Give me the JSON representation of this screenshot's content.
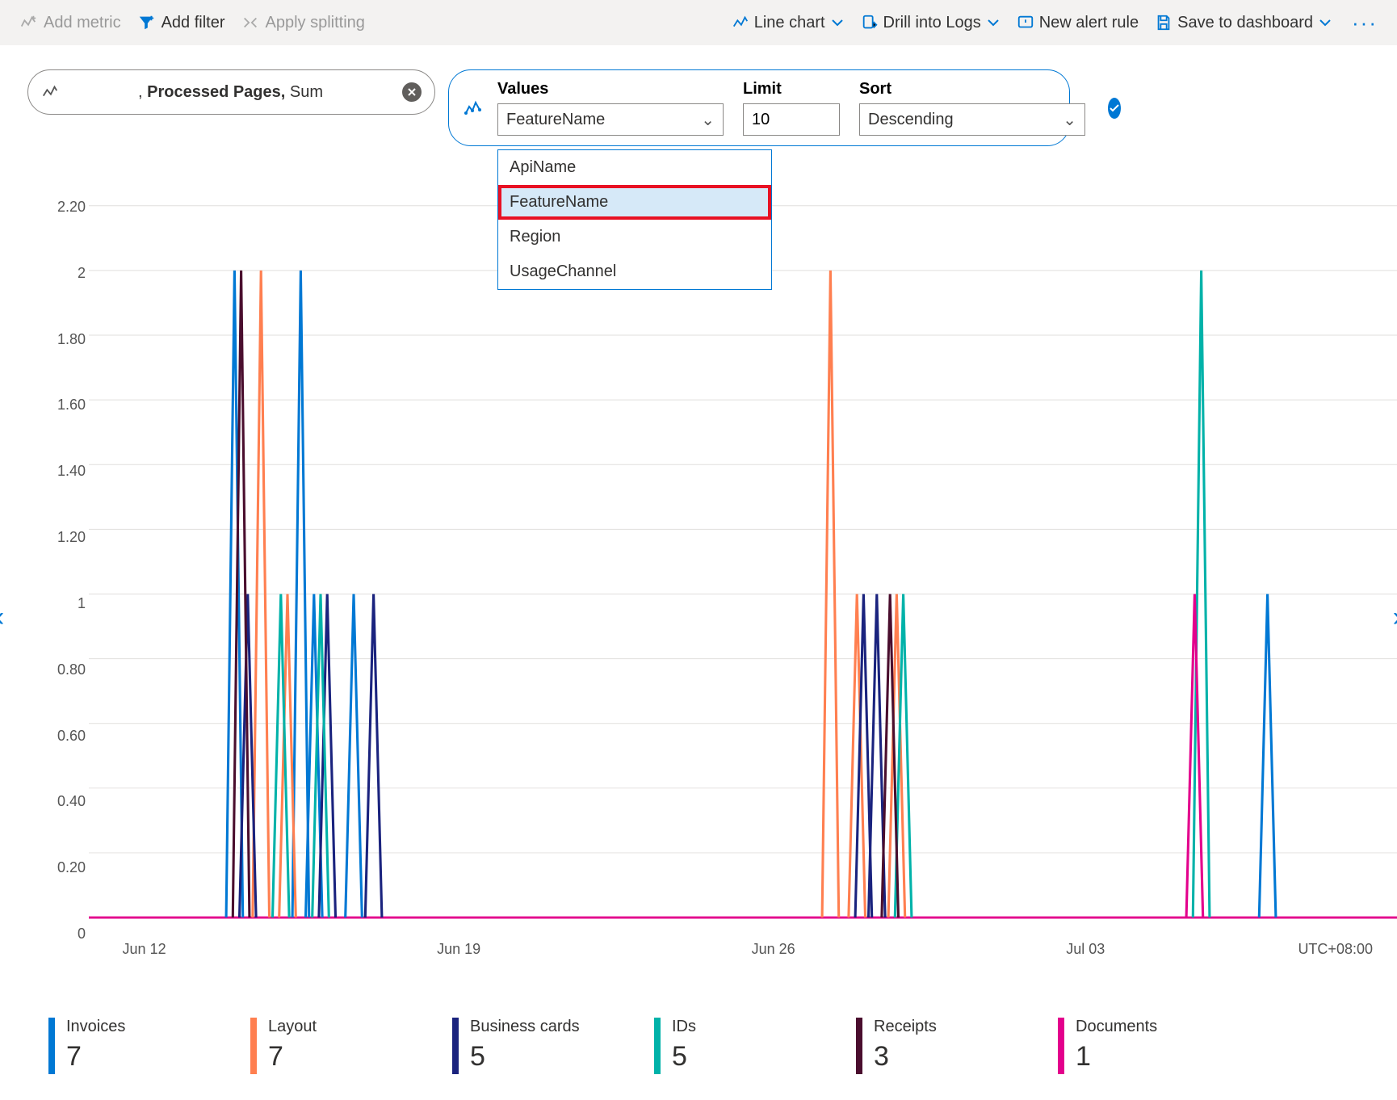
{
  "toolbar": {
    "addMetric": "Add metric",
    "addFilter": "Add filter",
    "applySplitting": "Apply splitting",
    "lineChart": "Line chart",
    "drillLogs": "Drill into Logs",
    "newAlert": "New alert rule",
    "saveDash": "Save to dashboard"
  },
  "metricPill": {
    "prefix": ", ",
    "metric": "Processed Pages,",
    "agg": " Sum"
  },
  "split": {
    "valuesLabel": "Values",
    "valuesValue": "FeatureName",
    "limitLabel": "Limit",
    "limitValue": "10",
    "sortLabel": "Sort",
    "sortValue": "Descending",
    "dropdown": [
      "ApiName",
      "FeatureName",
      "Region",
      "UsageChannel"
    ],
    "selectedIndex": 1
  },
  "chart": {
    "yTicks": [
      "2.20",
      "2",
      "1.80",
      "1.60",
      "1.40",
      "1.20",
      "1",
      "0.80",
      "0.60",
      "0.40",
      "0.20",
      "0"
    ],
    "xTicks": [
      "Jun 12",
      "Jun 19",
      "Jun 26",
      "Jul 03"
    ],
    "tz": "UTC+08:00"
  },
  "legend": [
    {
      "name": "Invoices",
      "value": "7",
      "color": "#0078d4"
    },
    {
      "name": "Layout",
      "value": "7",
      "color": "#ff7f50"
    },
    {
      "name": "Business cards",
      "value": "5",
      "color": "#1a237e"
    },
    {
      "name": "IDs",
      "value": "5",
      "color": "#00b2a9"
    },
    {
      "name": "Receipts",
      "value": "3",
      "color": "#4a0e2e"
    },
    {
      "name": "Documents",
      "value": "1",
      "color": "#e3008c"
    }
  ],
  "chart_data": {
    "type": "line",
    "title": "",
    "xlabel": "",
    "ylabel": "",
    "ylim": [
      0,
      2.2
    ],
    "x_dates": [
      "Jun 12",
      "Jun 19",
      "Jun 26",
      "Jul 03"
    ],
    "tz": "UTC+08:00",
    "series": [
      {
        "name": "Invoices",
        "color": "#0078d4",
        "total": 7,
        "points": [
          {
            "x": 0.11,
            "y": 2
          },
          {
            "x": 0.16,
            "y": 2
          },
          {
            "x": 0.17,
            "y": 1
          },
          {
            "x": 0.2,
            "y": 1
          },
          {
            "x": 0.89,
            "y": 1
          }
        ]
      },
      {
        "name": "Layout",
        "color": "#ff7f50",
        "total": 7,
        "points": [
          {
            "x": 0.13,
            "y": 2
          },
          {
            "x": 0.15,
            "y": 1
          },
          {
            "x": 0.56,
            "y": 2
          },
          {
            "x": 0.58,
            "y": 1
          },
          {
            "x": 0.61,
            "y": 1
          }
        ]
      },
      {
        "name": "Business cards",
        "color": "#1a237e",
        "total": 5,
        "points": [
          {
            "x": 0.12,
            "y": 1
          },
          {
            "x": 0.18,
            "y": 1
          },
          {
            "x": 0.215,
            "y": 1
          },
          {
            "x": 0.585,
            "y": 1
          },
          {
            "x": 0.595,
            "y": 1
          }
        ]
      },
      {
        "name": "IDs",
        "color": "#00b2a9",
        "total": 5,
        "points": [
          {
            "x": 0.145,
            "y": 1
          },
          {
            "x": 0.175,
            "y": 1
          },
          {
            "x": 0.615,
            "y": 1
          },
          {
            "x": 0.84,
            "y": 2
          }
        ]
      },
      {
        "name": "Receipts",
        "color": "#4a0e2e",
        "total": 3,
        "points": [
          {
            "x": 0.115,
            "y": 2
          },
          {
            "x": 0.605,
            "y": 1
          }
        ]
      },
      {
        "name": "Documents",
        "color": "#e3008c",
        "total": 1,
        "points": [
          {
            "x": 0.835,
            "y": 1
          }
        ]
      }
    ]
  }
}
